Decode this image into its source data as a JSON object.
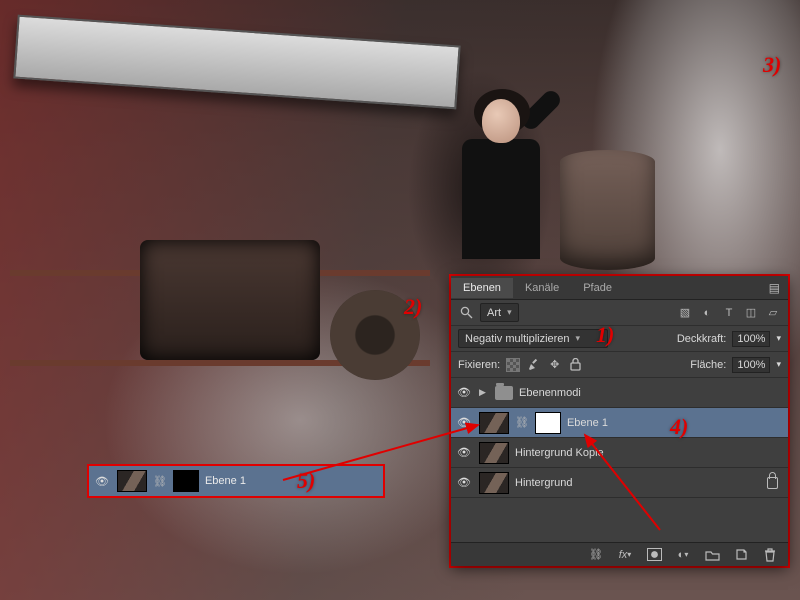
{
  "tabs": {
    "layers": "Ebenen",
    "channels": "Kanäle",
    "paths": "Pfade"
  },
  "filter": {
    "label": "Art"
  },
  "blend": {
    "mode": "Negativ multiplizieren",
    "opacity_label": "Deckkraft:",
    "opacity_value": "100%"
  },
  "lock": {
    "label": "Fixieren:",
    "fill_label": "Fläche:",
    "fill_value": "100%"
  },
  "layers": {
    "group": {
      "name": "Ebenenmodi"
    },
    "ebene1": {
      "name": "Ebene 1"
    },
    "kopie": {
      "name": "Hintergrund Kopie"
    },
    "bg": {
      "name": "Hintergrund"
    }
  },
  "strip": {
    "name": "Ebene 1"
  },
  "annotations": {
    "n1": "1)",
    "n2": "2)",
    "n3": "3)",
    "n4": "4)",
    "n5": "5)"
  }
}
